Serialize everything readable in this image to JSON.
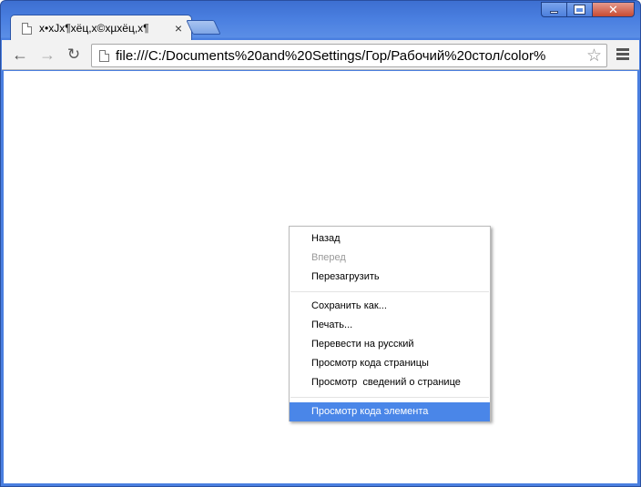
{
  "tab": {
    "title": "x•xJx¶xёц,x©xµxёц,x¶",
    "close_glyph": "×"
  },
  "window_controls": {
    "close_glyph": "✕"
  },
  "toolbar": {
    "back_glyph": "←",
    "forward_glyph": "→",
    "reload_glyph": "↻",
    "url": "file:///C:/Documents%20and%20Settings/Гор/Рабочий%20стол/color%",
    "star_glyph": "☆"
  },
  "context_menu": {
    "groups": [
      [
        {
          "label": "Назад",
          "enabled": true
        },
        {
          "label": "Вперед",
          "enabled": false
        },
        {
          "label": "Перезагрузить",
          "enabled": true
        }
      ],
      [
        {
          "label": "Сохранить как...",
          "enabled": true
        },
        {
          "label": "Печать...",
          "enabled": true
        },
        {
          "label": "Перевести на русский",
          "enabled": true
        },
        {
          "label": "Просмотр кода страницы",
          "enabled": true
        },
        {
          "label": "Просмотр  сведений о странице",
          "enabled": true
        }
      ],
      [
        {
          "label": "Просмотр кода элемента",
          "enabled": true,
          "highlighted": true
        }
      ]
    ]
  },
  "colors": {
    "title_bar": "#4a7fe0",
    "menu_highlight": "#4a86e8",
    "disabled_text": "#999999"
  }
}
